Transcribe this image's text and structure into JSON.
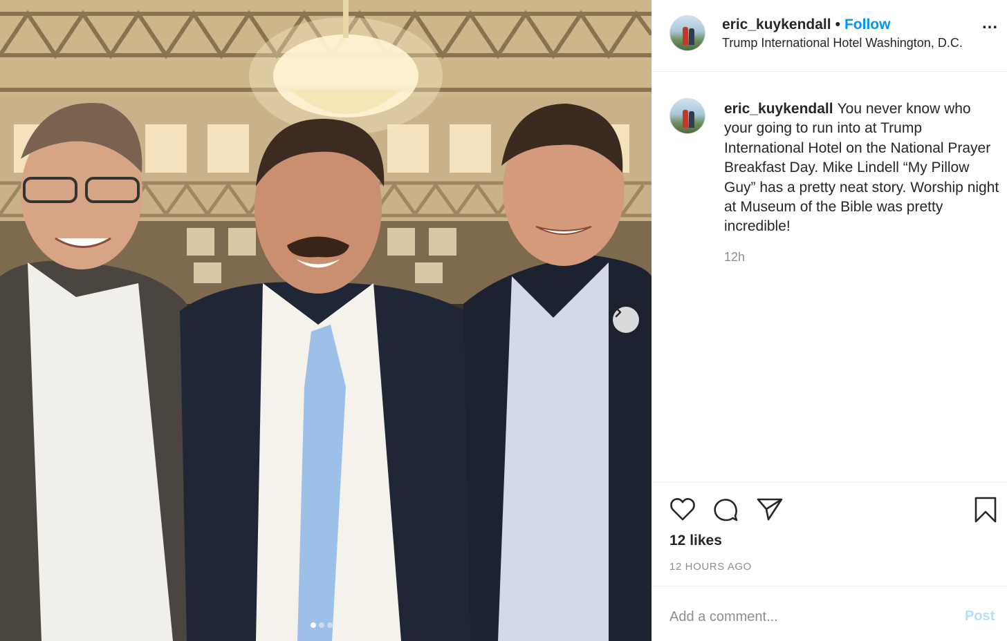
{
  "post": {
    "username": "eric_kuykendall",
    "separator": "•",
    "follow_label": "Follow",
    "location": "Trump International Hotel Washington, D.C.",
    "more_label": "...",
    "caption_username": "eric_kuykendall",
    "caption_text": "You never know who your going to run into at Trump International Hotel on the National Prayer Breakfast Day. Mike Lindell “My Pillow Guy” has a pretty neat story. Worship night at Museum of the Bible was pretty incredible!",
    "caption_time": "12h",
    "likes": "12 likes",
    "time_ago": "12 HOURS AGO",
    "comment_placeholder": "Add a comment...",
    "post_label": "Post"
  },
  "carousel": {
    "total": 3,
    "active_index": 0
  },
  "icons": {
    "like": "heart-icon",
    "comment": "comment-bubble-icon",
    "share": "paper-plane-icon",
    "save": "bookmark-icon",
    "next": "chevron-right-icon"
  },
  "colors": {
    "accent": "#0095f6",
    "muted": "#8e8e8e",
    "post_disabled": "#b2dffc"
  }
}
